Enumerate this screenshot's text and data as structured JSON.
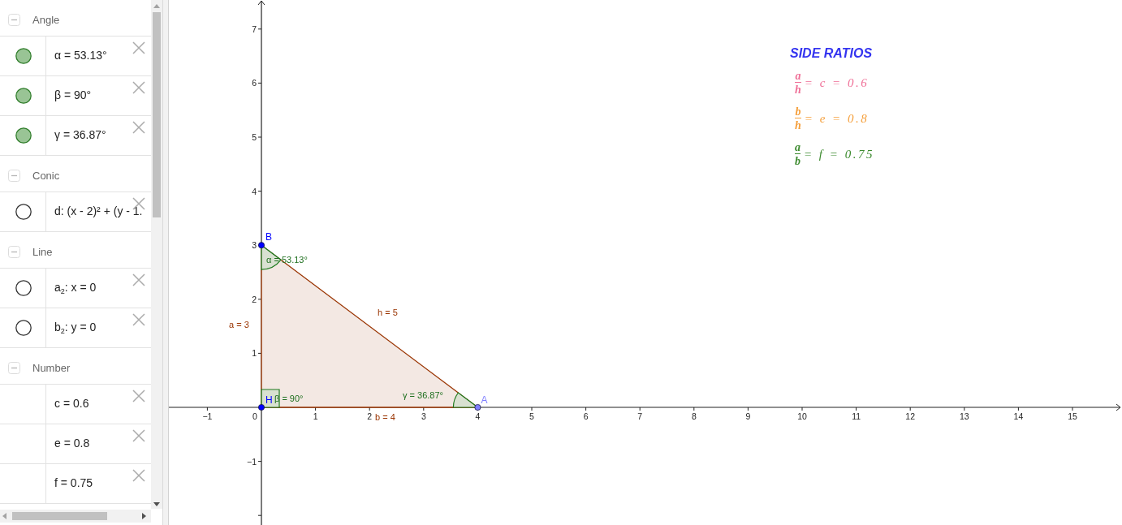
{
  "algebra_view": {
    "groups": [
      {
        "title": "Angle",
        "expanded": true,
        "items": [
          {
            "text": "α = 53.13°",
            "visible": true
          },
          {
            "text": "β = 90°",
            "visible": true
          },
          {
            "text": "γ = 36.87°",
            "visible": true
          }
        ]
      },
      {
        "title": "Conic",
        "expanded": true,
        "items": [
          {
            "text": "d: (x - 2)² + (y - 1.",
            "visible": false
          }
        ]
      },
      {
        "title": "Line",
        "expanded": true,
        "items": [
          {
            "text": "a$_{2}$: x = 0",
            "visible": false
          },
          {
            "text": "b$_{2}$: y = 0",
            "visible": false
          }
        ]
      },
      {
        "title": "Number",
        "expanded": true,
        "items": [
          {
            "text": "c = 0.6"
          },
          {
            "text": "e = 0.8"
          },
          {
            "text": "f = 0.75"
          }
        ]
      }
    ]
  },
  "graphics_view": {
    "x_axis": {
      "negative_labels": [
        "−1"
      ],
      "origin_label": "0",
      "positive_labels": [
        "1",
        "2",
        "3",
        "4",
        "5",
        "6",
        "7",
        "8",
        "9",
        "10",
        "11",
        "12",
        "13",
        "14",
        "15"
      ]
    },
    "y_axis": {
      "positive_labels": [
        "7",
        "6",
        "5",
        "4",
        "3",
        "2",
        "1"
      ],
      "negative_labels": [
        "−1"
      ]
    },
    "triangle": {
      "points": [
        {
          "label": "B",
          "color": "#0000ff"
        },
        {
          "label": "H",
          "color": "#0000ff"
        },
        {
          "label": "A",
          "color": "#7f7fff"
        }
      ],
      "segments": [
        {
          "label": "a = 3"
        },
        {
          "label": "h = 5"
        },
        {
          "label": "b = 4"
        }
      ],
      "angles": [
        {
          "label": "α = 53.13°",
          "kind": "arc"
        },
        {
          "label": "β = 90°",
          "kind": "right"
        },
        {
          "label": "γ = 36.87°",
          "kind": "arc"
        }
      ]
    },
    "side_ratios": {
      "title": "SIDE RATIOS",
      "ratios": [
        {
          "numerator": "a",
          "denominator": "h",
          "equation": "= c = 0.6",
          "color": "#ef6f97"
        },
        {
          "numerator": "b",
          "denominator": "h",
          "equation": "= e = 0.8",
          "color": "#f59f3b"
        },
        {
          "numerator": "a",
          "denominator": "b",
          "equation": "= f = 0.75",
          "color": "#3d8b2f"
        }
      ]
    }
  }
}
